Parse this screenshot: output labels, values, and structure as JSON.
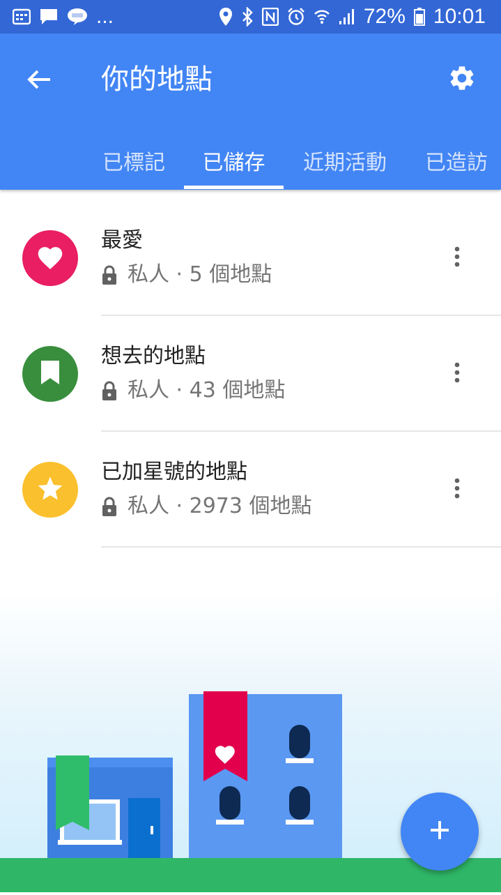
{
  "status_bar": {
    "battery_percent": "72%",
    "time": "10:01",
    "overflow_indicator": "...",
    "notification_icons": [
      "calendar-icon",
      "chat-bubble-icon",
      "line-app-icon"
    ],
    "system_icons": [
      "location-icon",
      "bluetooth-icon",
      "nfc-icon",
      "alarm-icon",
      "wifi-icon",
      "signal-icon",
      "battery-icon"
    ]
  },
  "app_bar": {
    "title": "你的地點",
    "back_icon": "arrow-back-icon",
    "settings_icon": "gear-icon",
    "tabs": [
      {
        "label": "已標記",
        "active": false
      },
      {
        "label": "已儲存",
        "active": true
      },
      {
        "label": "近期活動",
        "active": false
      },
      {
        "label": "已造訪",
        "active": false
      }
    ]
  },
  "lists": [
    {
      "title": "最愛",
      "privacy": "私人",
      "separator": " · ",
      "count": "5 個地點",
      "icon": "heart-icon",
      "color": "#e91e63"
    },
    {
      "title": "想去的地點",
      "privacy": "私人",
      "separator": " · ",
      "count": "43 個地點",
      "icon": "bookmark-icon",
      "color": "#388e3c"
    },
    {
      "title": "已加星號的地點",
      "privacy": "私人",
      "separator": " · ",
      "count": "2973 個地點",
      "icon": "star-icon",
      "color": "#fbc02d"
    }
  ],
  "fab": {
    "icon": "plus-icon"
  },
  "colors": {
    "status_bar": "#3367d6",
    "app_bar": "#4285f4",
    "ground": "#2fb767"
  }
}
